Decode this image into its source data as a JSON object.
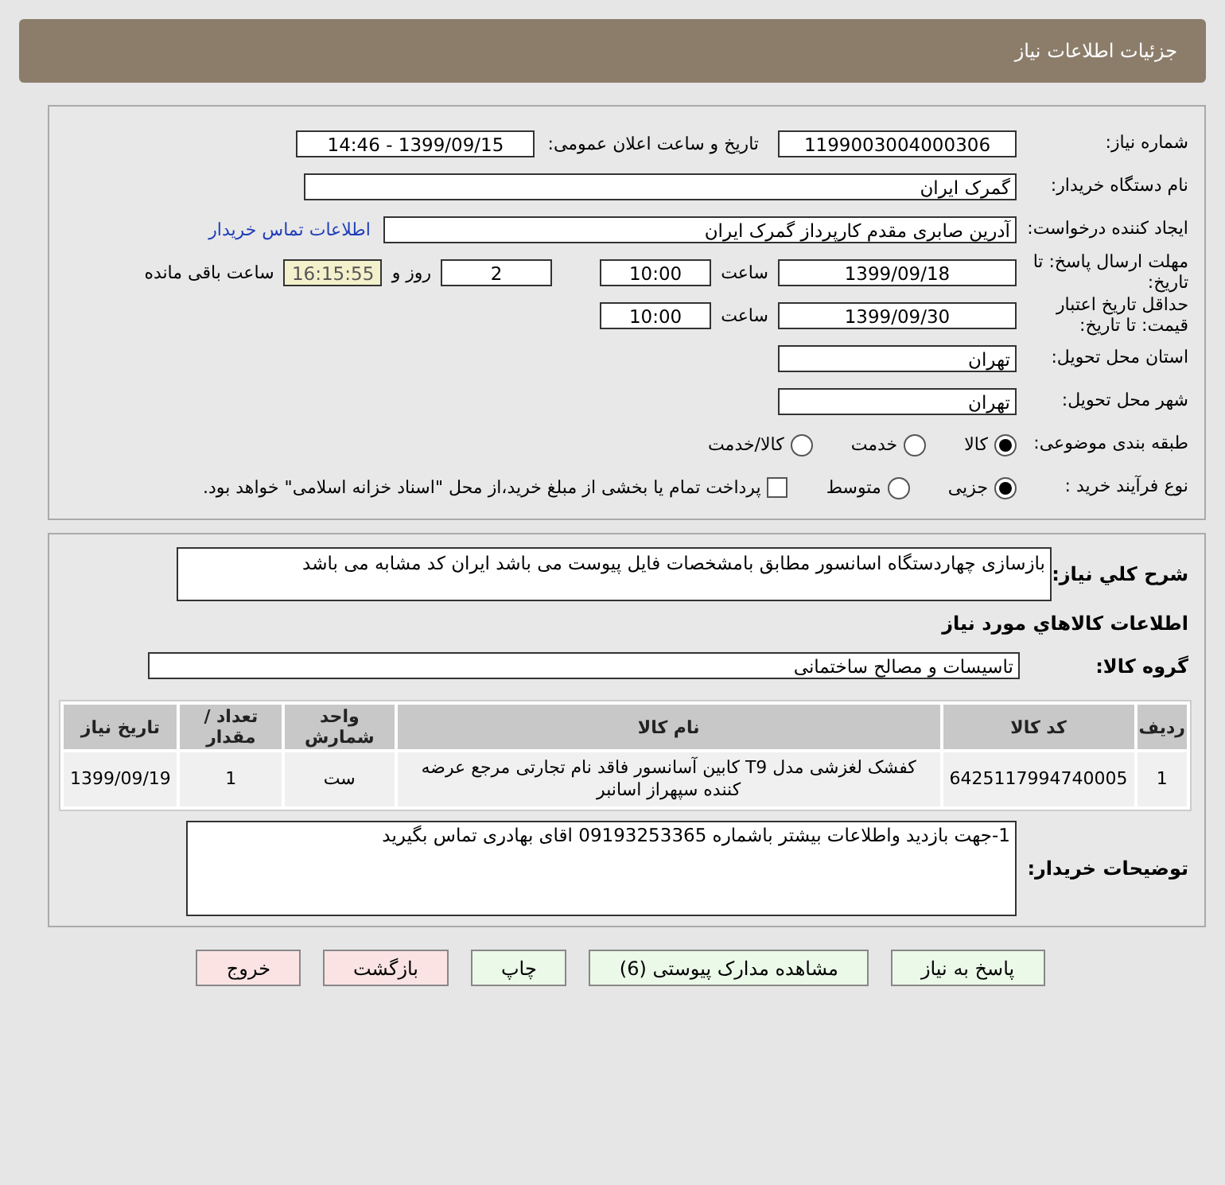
{
  "header": {
    "title": "جزئیات اطلاعات نیاز"
  },
  "need_number": {
    "label": "شماره نیاز:",
    "value": "1199003004000306"
  },
  "announce": {
    "label": "تاریخ و ساعت اعلان عمومی:",
    "value": "1399/09/15 - 14:46"
  },
  "buyer_org": {
    "label": "نام دستگاه خریدار:",
    "value": "گمرک ایران"
  },
  "creator": {
    "label": "ایجاد کننده درخواست:",
    "value": "آدرین صابری مقدم کارپرداز گمرک ایران",
    "link": "اطلاعات تماس خریدار"
  },
  "deadline": {
    "label": "مهلت ارسال پاسخ: تا تاریخ:",
    "date": "1399/09/18",
    "time_label": "ساعت",
    "time": "10:00",
    "days": "2",
    "days_label": "روز و",
    "remaining": "16:15:55",
    "remaining_label": "ساعت باقی مانده"
  },
  "validity": {
    "label": "حداقل تاریخ اعتبار قیمت: تا تاریخ:",
    "date": "1399/09/30",
    "time_label": "ساعت",
    "time": "10:00"
  },
  "province": {
    "label": "استان محل تحویل:",
    "value": "تهران"
  },
  "city": {
    "label": "شهر محل تحویل:",
    "value": "تهران"
  },
  "category": {
    "label": "طبقه بندی موضوعی:",
    "options": [
      {
        "label": "کالا",
        "selected": true
      },
      {
        "label": "خدمت",
        "selected": false
      },
      {
        "label": "کالا/خدمت",
        "selected": false
      }
    ]
  },
  "purchase_type": {
    "label": "نوع فرآیند خرید :",
    "options": [
      {
        "label": "جزیی",
        "selected": true
      },
      {
        "label": "متوسط",
        "selected": false
      }
    ],
    "treasury": {
      "label": "پرداخت تمام یا بخشی از مبلغ خرید،از محل \"اسناد خزانه اسلامی\" خواهد بود.",
      "checked": false
    }
  },
  "description": {
    "label": "شرح كلي نياز:",
    "value": "بازسازی چهاردستگاه اسانسور مطابق بامشخصات فایل پیوست می باشد ایران کد مشابه می باشد"
  },
  "goods_heading": "اطلاعات كالاهاي مورد نياز",
  "goods_group": {
    "label": "گروه کالا:",
    "value": "تاسیسات و مصالح ساختمانی"
  },
  "table": {
    "columns": [
      "ردیف",
      "کد کالا",
      "نام کالا",
      "واحد شمارش",
      "تعداد / مقدار",
      "تاریخ نیاز"
    ],
    "rows": [
      [
        "1",
        "6425117994740005",
        "کفشک لغزشی مدل T9 کابین آسانسور فاقد نام تجارتی مرجع عرضه کننده سپهراز اسانبر",
        "ست",
        "1",
        "1399/09/19"
      ]
    ]
  },
  "buyer_notes": {
    "label": "توضیحات خریدار:",
    "value": "1-جهت بازدید واطلاعات بیشتر باشماره 09193253365 اقای بهادری تماس بگیرید"
  },
  "buttons": [
    {
      "label": "پاسخ به نیاز",
      "kind": "normal"
    },
    {
      "label": "مشاهده مدارک پیوستی (6)",
      "kind": "normal"
    },
    {
      "label": "چاپ",
      "kind": "normal"
    },
    {
      "label": "بازگشت",
      "kind": "danger"
    },
    {
      "label": "خروج",
      "kind": "danger"
    }
  ]
}
